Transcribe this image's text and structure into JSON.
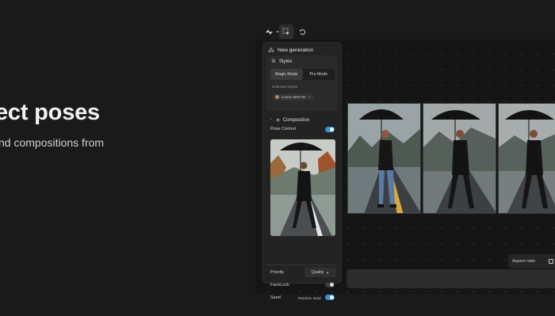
{
  "hero": {
    "title": "ect poses",
    "subtitle": "nd compositions from"
  },
  "toolbar": {
    "items": [
      {
        "icon": "crop-icon",
        "glyph": "⌗"
      },
      {
        "icon": "select-icon",
        "glyph": "⬚"
      },
      {
        "icon": "undo-icon",
        "glyph": "↶"
      }
    ]
  },
  "panel": {
    "header": "New generation",
    "styles": {
      "title": "Styles",
      "tabs": [
        "Magic Mode",
        "Pro Mode"
      ],
      "active_tab": "Magic Mode",
      "selected_label": "Selected styles",
      "chip": "Canon 5DS Re"
    },
    "composition": {
      "title": "Composition",
      "pose_control": "Pose Control",
      "pose_control_on": true
    },
    "facelock": "FaceLock",
    "facelock_on": false,
    "seed": "Seed",
    "seed_value": "Random seed",
    "seed_on": true,
    "priority": "Priority",
    "priority_value": "Quality"
  },
  "aspect": {
    "label": "Aspect ratio"
  },
  "colors": {
    "accent": "#3a8fd8",
    "background": "#1a1a1a",
    "panel": "#232323"
  }
}
